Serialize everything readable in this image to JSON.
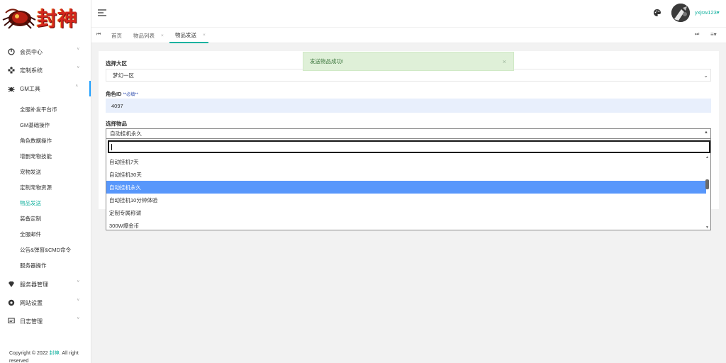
{
  "logo": {
    "text": "封神"
  },
  "sidebar": {
    "items": [
      {
        "label": "会员中心",
        "icon": "user-circle-icon"
      },
      {
        "label": "定制系统",
        "icon": "apps-icon"
      },
      {
        "label": "GM工具",
        "icon": "bug-icon"
      }
    ],
    "sub_items": [
      "全服补发平台币",
      "GM基础操作",
      "角色数据操作",
      "增删宠物技能",
      "宠物发送",
      "定制宠物资源",
      "物品发送",
      "装备定制",
      "全服邮件",
      "公告&弹窗&CMD命令",
      "服务器操作"
    ],
    "bottom_items": [
      {
        "label": "服务器管理",
        "icon": "diamond-icon"
      },
      {
        "label": "网站设置",
        "icon": "settings-circle-icon"
      },
      {
        "label": "日志管理",
        "icon": "message-icon"
      }
    ],
    "active_sub": "物品发送"
  },
  "footer": {
    "prefix": "Copyright © 2022 ",
    "brand": "封神",
    "suffix": ". All right reserved"
  },
  "header": {
    "username": "yxjsw123"
  },
  "tabs": [
    {
      "label": "首页",
      "closable": false
    },
    {
      "label": "物品列表",
      "closable": true
    },
    {
      "label": "物品发送",
      "closable": true,
      "active": true
    }
  ],
  "form": {
    "region_label": "选择大区",
    "region_value": "梦幻一区",
    "role_label": "角色ID",
    "role_required": "**必填**",
    "role_value": "4097",
    "item_label": "选择物品",
    "item_value": "自动挂机永久"
  },
  "dropdown": {
    "options": [
      "自动挂机7天",
      "自动挂机30天",
      "自动挂机永久",
      "自动挂机10分钟体验",
      "定制专属称谓",
      "300W爆金币"
    ],
    "highlighted_index": 2
  },
  "toast": {
    "message": "发送物品成功!"
  },
  "colors": {
    "accent": "#16b2a0",
    "highlight": "#5897fb",
    "toast_bg": "#dff0d8"
  }
}
